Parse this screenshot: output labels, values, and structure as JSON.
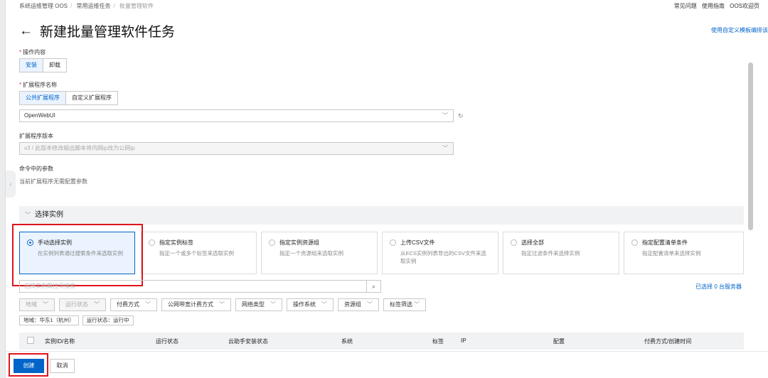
{
  "breadcrumb": [
    "系统运维管理 OOS",
    "常用运维任务",
    "批量管理软件"
  ],
  "top_links": [
    "常见问题",
    "使用指南",
    "OOS欢迎页"
  ],
  "page_title": "新建批量管理软件任务",
  "template_link": "使用自定义模板编排该",
  "operation": {
    "label": "操作内容",
    "options": [
      "安装",
      "卸载"
    ],
    "selected": "安装"
  },
  "extension": {
    "label": "扩展程序名称",
    "tabs": [
      "公共扩展程序",
      "自定义扩展程序"
    ],
    "selected_tab": "公共扩展程序",
    "value": "OpenWebUI"
  },
  "version": {
    "label": "扩展程序版本",
    "value": "v3 / 此版本修改输出脚本将内网ip改为公网ip"
  },
  "params": {
    "label": "命令中的参数",
    "hint": "当前扩展程序无需配置参数"
  },
  "instance_section": {
    "title": "选择实例",
    "cards": [
      {
        "title": "手动选择实例",
        "desc": "在实例列表通过搜索条件来选取实例"
      },
      {
        "title": "指定实例标签",
        "desc": "指定一个或多个标签来选取实例"
      },
      {
        "title": "指定实例资源组",
        "desc": "指定一个资源组来选取实例"
      },
      {
        "title": "上传CSV文件",
        "desc": "从ECS实例列表导出的CSV文件来选取实例"
      },
      {
        "title": "选择全部",
        "desc": "指定过滤条件来选择实例"
      },
      {
        "title": "指定配置清单条件",
        "desc": "指定配置清单来选择实例"
      }
    ],
    "selected_card": 0,
    "search_placeholder": "选择实例属性项搜索",
    "selected_count": "已选择 0 台服务器",
    "filters": [
      "地域",
      "运行状态",
      "付费方式",
      "公网带宽计费方式",
      "网络类型",
      "操作系统",
      "资源组",
      "标签筛选"
    ],
    "tags": [
      "地域：华东1（杭州）",
      "运行状态：运行中"
    ],
    "columns": [
      "实例ID/名称",
      "运行状态",
      "云助手安装状态",
      "系统",
      "标签",
      "IP",
      "配置",
      "付费方式/创建时间"
    ]
  },
  "footer": {
    "create": "创建",
    "cancel": "取消"
  },
  "colors": {
    "primary": "#0064c8",
    "highlight": "#e0141e",
    "required": "#d93026"
  }
}
